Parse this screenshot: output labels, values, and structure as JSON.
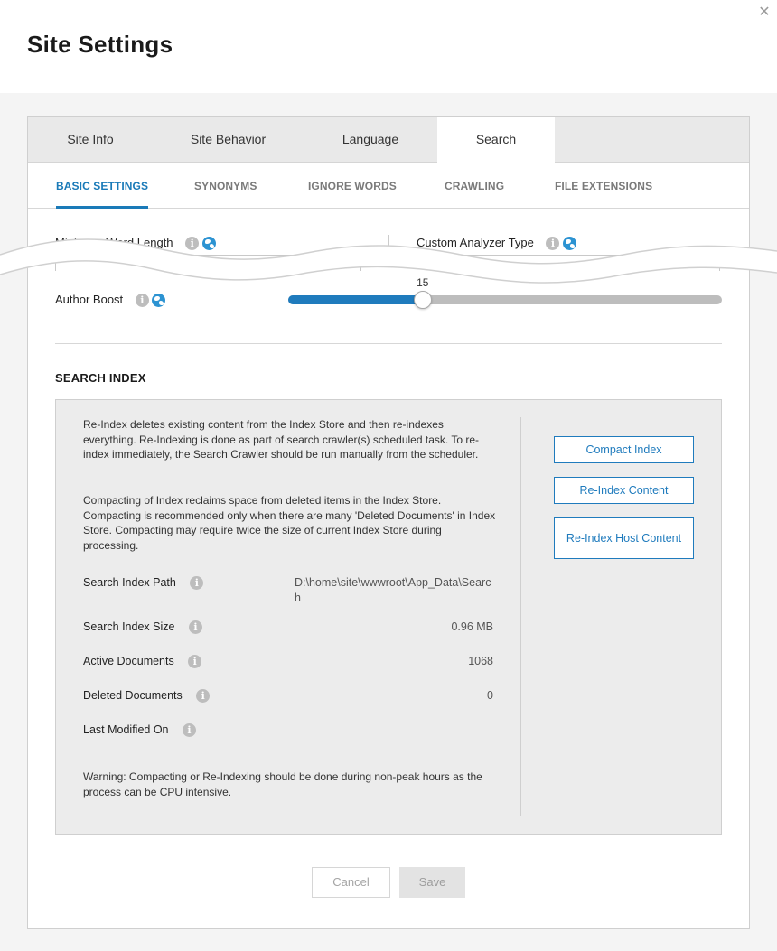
{
  "window": {
    "title": "Site Settings",
    "close_glyph": "✕"
  },
  "tabs": [
    {
      "label": "Site Info",
      "active": false
    },
    {
      "label": "Site Behavior",
      "active": false
    },
    {
      "label": "Language",
      "active": false
    },
    {
      "label": "Search",
      "active": true
    }
  ],
  "subtabs": [
    {
      "label": "BASIC SETTINGS",
      "active": true
    },
    {
      "label": "SYNONYMS",
      "active": false
    },
    {
      "label": "IGNORE WORDS",
      "active": false
    },
    {
      "label": "CRAWLING",
      "active": false
    },
    {
      "label": "FILE EXTENSIONS",
      "active": false
    }
  ],
  "fields": {
    "min_word_length_label": "Minimum Word Length",
    "custom_analyzer_label": "Custom Analyzer Type",
    "author_boost_label": "Author Boost",
    "author_boost_value": "15",
    "author_boost_fraction": 0.31
  },
  "search_index": {
    "title": "SEARCH INDEX",
    "desc1": "Re-Index deletes existing content from the Index Store and then re-indexes everything. Re-Indexing is done as part of search crawler(s) scheduled task. To re-index immediately, the Search Crawler should be run manually from the scheduler.",
    "desc2": "Compacting of Index reclaims space from deleted items in the Index Store. Compacting is recommended only when there are many 'Deleted Documents' in Index Store. Compacting may require twice the size of current Index Store during processing.",
    "path_label": "Search Index Path",
    "path_value": "D:\\home\\site\\wwwroot\\App_Data\\Search",
    "size_label": "Search Index Size",
    "size_value": "0.96 MB",
    "active_label": "Active Documents",
    "active_value": "1068",
    "deleted_label": "Deleted Documents",
    "deleted_value": "0",
    "modified_label": "Last Modified On",
    "modified_value": "",
    "warning": "Warning: Compacting or Re-Indexing should be done during non-peak hours as the process can be CPU intensive.",
    "buttons": {
      "compact": "Compact Index",
      "reindex": "Re-Index Content",
      "reindex_host": "Re-Index Host Content"
    }
  },
  "footer": {
    "cancel": "Cancel",
    "save": "Save"
  },
  "colors": {
    "accent": "#1f7bbd",
    "panel_bg": "#ececec",
    "tab_bar_bg": "#e9e9e9"
  }
}
